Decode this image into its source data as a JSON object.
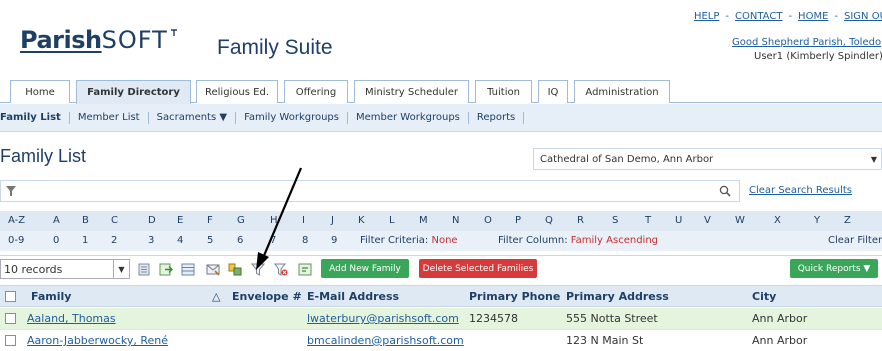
{
  "header": {
    "logo_parish": "Parish",
    "logo_soft": "SOFT",
    "app_title": "Family Suite",
    "top_links": [
      "HELP",
      "CONTACT",
      "HOME",
      "SIGN OUT"
    ],
    "parish_name": "Good Shepherd Parish, Toledo",
    "user_name": "User1 (Kimberly Spindler)"
  },
  "tabs": [
    "Home",
    "Family Directory",
    "Religious Ed.",
    "Offering",
    "Ministry Scheduler",
    "Tuition",
    "IQ",
    "Administration"
  ],
  "active_tab": "Family Directory",
  "subnav": [
    "Family List",
    "Member List",
    "Sacraments ▼",
    "Family Workgroups",
    "Member Workgroups",
    "Reports"
  ],
  "page": {
    "title": "Family List",
    "parish_select": "Cathedral of San Demo, Ann Arbor"
  },
  "search": {
    "placeholder": "",
    "clear_label": "Clear Search Results"
  },
  "alpha_row1": [
    "A-Z",
    "A",
    "B",
    "C",
    "D",
    "E",
    "F",
    "G",
    "H",
    "I",
    "J",
    "K",
    "L",
    "M",
    "N",
    "O",
    "P",
    "Q",
    "R",
    "S",
    "T",
    "U",
    "V",
    "W",
    "X",
    "Y",
    "Z"
  ],
  "alpha_row2": [
    "0-9",
    "0",
    "1",
    "2",
    "3",
    "4",
    "5",
    "6",
    "7",
    "8",
    "9"
  ],
  "filter": {
    "criteria_label": "Filter Criteria:",
    "criteria_value": "None",
    "column_label": "Filter Column:",
    "column_value": "Family Ascending",
    "clear_label": "Clear Filter"
  },
  "toolbar": {
    "records": "10 records",
    "add_family": "Add New Family",
    "delete_families": "Delete Selected Families",
    "quick_reports": "Quick Reports ▼"
  },
  "table": {
    "headers": [
      "Family",
      "Envelope #",
      "E-Mail Address",
      "Primary Phone",
      "Primary Address",
      "City"
    ],
    "sort_indicator": "△",
    "rows": [
      {
        "family": "Aaland, Thomas",
        "envelope": "",
        "email": "lwaterbury@parishsoft.com",
        "phone": "1234578",
        "address": "555 Notta Street",
        "city": "Ann Arbor"
      },
      {
        "family": "Aaron-Jabberwocky, René",
        "envelope": "",
        "email": "bmcalinden@parishsoft.com",
        "phone": "",
        "address": "123 N Main St",
        "city": "Ann Arbor"
      }
    ]
  },
  "colors": {
    "brand": "#1f3f66",
    "link": "#1f5fa0",
    "highlight_row": "#e5f4dc",
    "green_button": "#3aa65a",
    "red_button": "#d63a3a"
  }
}
